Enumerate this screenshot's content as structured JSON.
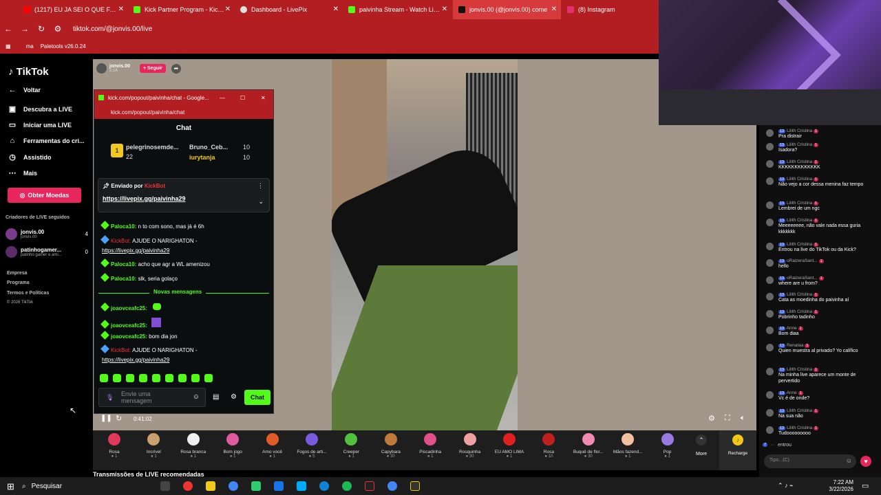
{
  "browser": {
    "tabs": [
      {
        "label": "(1217) EU JA SEI O QUE FAZER",
        "color": "#ff0000"
      },
      {
        "label": "Kick Partner Program - Kick Da",
        "color": "#53fc18"
      },
      {
        "label": "Dashboard - LivePix",
        "color": "#e0e0e0"
      },
      {
        "label": "paivinha Stream - Watch Live o",
        "color": "#53fc18"
      },
      {
        "label": "jonvis.00 (@jonvis.00) come",
        "color": "#111111"
      },
      {
        "label": "(8) Instagram",
        "color": "#e1306c"
      }
    ],
    "url": "tiktok.com/@jonvis.00/live",
    "bookmarks": [
      "ma",
      "Paletools v26.0.24"
    ]
  },
  "sidebar": {
    "logo": "TikTok",
    "back": "Voltar",
    "items": [
      "Descubra a LIVE",
      "Iniciar uma LIVE",
      "Ferramentas do cri...",
      "Assistido",
      "Mais"
    ],
    "coins_button": "Obter Moedas",
    "section_title": "Criadores de LIVE seguidos",
    "creators": [
      {
        "name": "jonvis.00",
        "sub": "jonvis.00",
        "count": "4"
      },
      {
        "name": "patinhogamer...",
        "sub": "patinho gamer e ami...",
        "count": "0"
      }
    ],
    "footer": [
      "Empresa",
      "Programa",
      "Termos e Políticas",
      "© 2026 TikTok"
    ]
  },
  "stream": {
    "host_name": "jonvis.00",
    "host_likes": "2.1K",
    "follow_button": "+ Seguir",
    "time": "0:41:02",
    "recommended": "Transmissões de LIVE recomendadas"
  },
  "popup": {
    "window_title": "kick.com/popout/paivinha/chat - Google...",
    "url": "kick.com/popout/paivinha/chat",
    "chat_title": "Chat",
    "leaderboard": [
      {
        "name": "pelegrinosemde...",
        "value": "22"
      },
      {
        "name": "Bruno_Ceb...",
        "value": "10"
      },
      {
        "name": "iurytanja",
        "value": "10"
      }
    ],
    "pinned_by": "Enviado por",
    "pinned_user": "KickBot",
    "pinned_link": "https://livepix.gg/paivinha29",
    "messages": [
      {
        "user": "Paloca10:",
        "text": "n to com sono, mas já é 6h"
      },
      {
        "user": "KickBot:",
        "text": "AJUDE O NARIGHATON -"
      },
      {
        "user": "",
        "text": "https://livepix.gg/paivinha29"
      },
      {
        "user": "Paloca10:",
        "text": "acho que agr a WL amenizou"
      },
      {
        "user": "Paloca10:",
        "text": "slk, seria golaço"
      }
    ],
    "new_messages": "Novas mensagens",
    "new": [
      {
        "user": "joaovceafc25:",
        "text": ""
      },
      {
        "user": "joaovceafc25:",
        "text": ""
      },
      {
        "user": "joaovceafc25:",
        "text": "bom dia jon"
      },
      {
        "user": "KickBot:",
        "text": "AJUDE O NARIGHATON -"
      },
      {
        "user": "",
        "text": "https://livepix.gg/paivinha29"
      }
    ],
    "input_placeholder": "Envie uma mensagem",
    "send_button": "Chat"
  },
  "gifts": [
    {
      "name": "Rosa",
      "price": "1"
    },
    {
      "name": "Incrível",
      "price": "1"
    },
    {
      "name": "Rosa branca",
      "price": "1"
    },
    {
      "name": "Bom jogo",
      "price": "1"
    },
    {
      "name": "Amo você",
      "price": "1"
    },
    {
      "name": "Fogos de arti...",
      "price": "5"
    },
    {
      "name": "Creeper",
      "price": "1"
    },
    {
      "name": "Capybara",
      "price": "30"
    },
    {
      "name": "Piscadinha",
      "price": "1"
    },
    {
      "name": "Rosquinha",
      "price": "30"
    },
    {
      "name": "EU AMO LIMA",
      "price": "1"
    },
    {
      "name": "Rosa",
      "price": "10"
    },
    {
      "name": "Buquê de flor...",
      "price": "30"
    },
    {
      "name": "Mãos fazend...",
      "price": "1"
    },
    {
      "name": "Pop",
      "price": "1"
    }
  ],
  "gift_more": "More",
  "recharge": "Recharge",
  "right_chat": {
    "messages": [
      {
        "user": "Lilith Cristina",
        "text": "Pra distrair"
      },
      {
        "user": "Lilith Cristina",
        "text": "Isadora?"
      },
      {
        "user": "Lilith Cristina",
        "text": "KKKKKKKKKKKKK"
      },
      {
        "user": "Lilith Cristina",
        "text": "Não vejo a cor dessa menina faz tempo"
      },
      {
        "user": "Lilith Cristina",
        "text": "Lembrei de um ngc"
      },
      {
        "user": "Lilith Cristina",
        "text": "Meeeeeeee, não vale nada essa guria kkkkkkk"
      },
      {
        "user": "Lilith Cristina",
        "text": "Entrou na live do TikTok ou da Kick?"
      },
      {
        "user": "oRaizeraSant...",
        "text": "hello"
      },
      {
        "user": "oRaizeraSant...",
        "text": "where are u from?"
      },
      {
        "user": "Lilith Cristina",
        "text": "Cata as moedinha do paivinha aí"
      },
      {
        "user": "Lilith Cristina",
        "text": "Pobrinho tadinho"
      },
      {
        "user": "Anne",
        "text": "Bom diaa"
      },
      {
        "user": "Renataa",
        "text": "Quien muestra al privado? Yo calífico"
      },
      {
        "user": "Lilith Cristina",
        "text": "Na minha live aparece um monte de pervertido"
      },
      {
        "user": "Anne",
        "text": "Vc é de onde?"
      },
      {
        "user": "Lilith Cristina",
        "text": "Na sua não"
      },
      {
        "user": "Lilith Cristina",
        "text": "Tudooooooooo"
      }
    ],
    "join_text": "entrou",
    "input_placeholder": "Tipo...(C)"
  },
  "taskbar": {
    "search": "Pesquisar",
    "time": "7:22 AM",
    "date": "3/22/2026"
  }
}
